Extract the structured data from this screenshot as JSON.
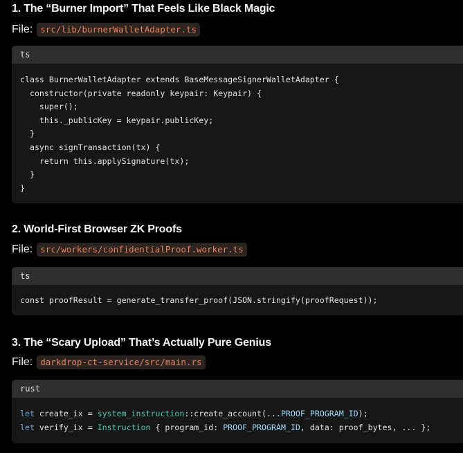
{
  "sections": [
    {
      "heading": "1. The “Burner Import” That Feels Like Black Magic",
      "file_label": "File:",
      "file_path": "src/lib/burnerWalletAdapter.ts",
      "lang": "ts",
      "code_lines": [
        "class BurnerWalletAdapter extends BaseMessageSignerWalletAdapter {",
        "  constructor(private readonly keypair: Keypair) {",
        "    super();",
        "    this._publicKey = keypair.publicKey;",
        "  }",
        "  async signTransaction(tx) {",
        "    return this.applySignature(tx);",
        "  }",
        "}"
      ]
    },
    {
      "heading": "2. World-First Browser ZK Proofs",
      "file_label": "File:",
      "file_path": "src/workers/confidentialProof.worker.ts",
      "lang": "ts",
      "code_lines": [
        "const proofResult = generate_transfer_proof(JSON.stringify(proofRequest));"
      ]
    },
    {
      "heading": "3. The “Scary Upload” That’s Actually Pure Genius",
      "file_label": "File:",
      "file_path": "darkdrop-ct-service/src/main.rs",
      "lang": "rust",
      "code_tokens": {
        "line1": {
          "kw": "let",
          "a": " create_ix = ",
          "fn": "system_instruction",
          "b": "::create_account(...",
          "cst": "PROOF_PROGRAM_ID",
          "c": ");"
        },
        "line2": {
          "kw": "let",
          "a": " verify_ix = ",
          "fn": "Instruction",
          "b": " { program_id: ",
          "cst": "PROOF_PROGRAM_ID",
          "c": ", data: proof_bytes, ... };"
        }
      }
    }
  ]
}
